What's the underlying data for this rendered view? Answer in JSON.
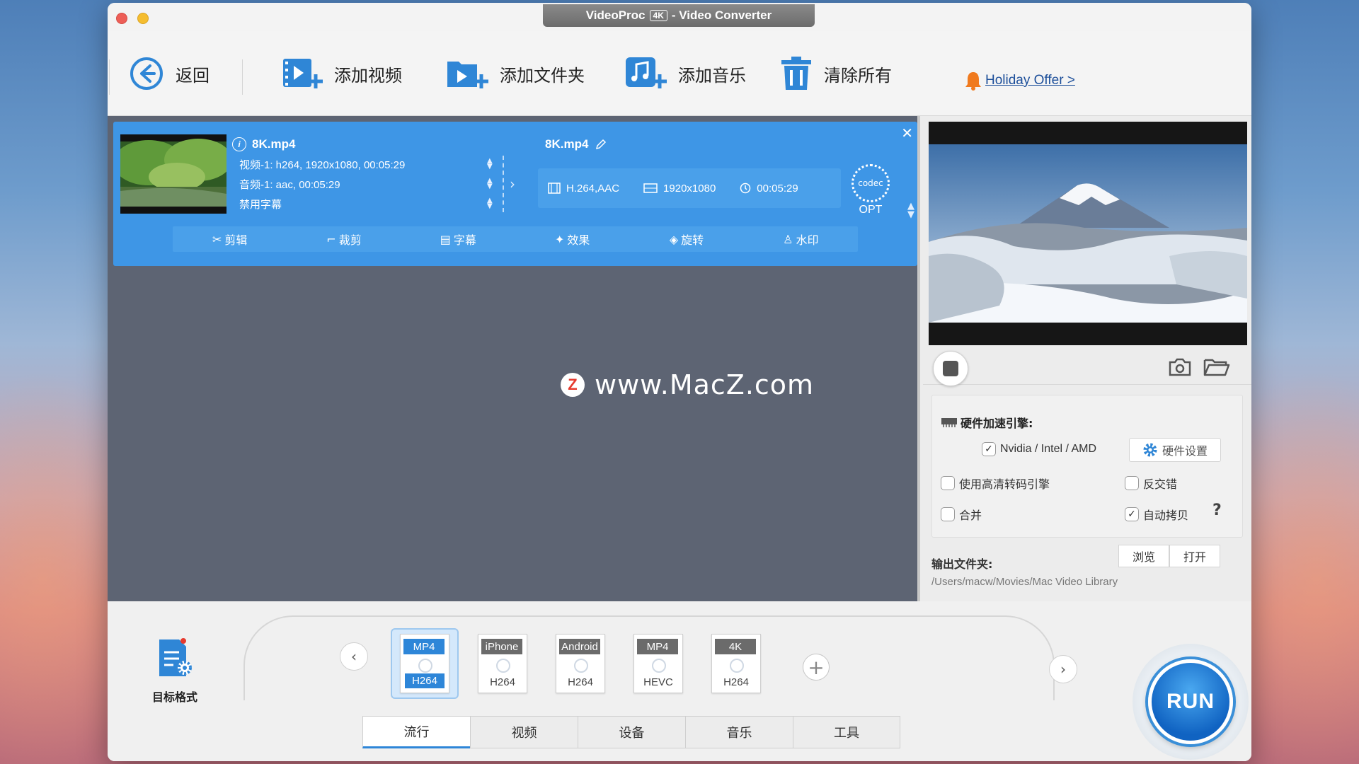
{
  "window": {
    "title_prefix": "VideoProc",
    "title_badge": "4K",
    "title_suffix": "- Video Converter"
  },
  "toolbar": {
    "back": "返回",
    "add_video": "添加视频",
    "add_folder": "添加文件夹",
    "add_music": "添加音乐",
    "clear_all": "清除所有",
    "holiday_offer": "Holiday Offer >"
  },
  "file_item": {
    "source_name": "8K.mp4",
    "video_track": "视频-1: h264, 1920x1080, 00:05:29",
    "audio_track": "音频-1: aac, 00:05:29",
    "subtitle": "禁用字幕",
    "output_name": "8K.mp4",
    "output_codec": "H.264,AAC",
    "output_resolution": "1920x1080",
    "output_duration": "00:05:29",
    "codec_label": "codec",
    "opt_label": "OPT"
  },
  "edit_bar": {
    "cut": "剪辑",
    "crop": "裁剪",
    "subtitle": "字幕",
    "effect": "效果",
    "rotate": "旋转",
    "watermark": "水印"
  },
  "watermark": {
    "logo": "Z",
    "text": "www.MacZ.com"
  },
  "settings": {
    "hw_title": "硬件加速引擎:",
    "hw_vendor": "Nvidia /  Intel / AMD",
    "hw_settings": "硬件设置",
    "hq_engine": "使用高清转码引擎",
    "deinterlace": "反交错",
    "merge": "合并",
    "auto_copy": "自动拷贝",
    "help": "?"
  },
  "output_folder": {
    "label": "输出文件夹:",
    "browse": "浏览",
    "open": "打开",
    "path": "/Users/macw/Movies/Mac Video Library"
  },
  "bottom": {
    "target_format": "目标格式",
    "formats": [
      {
        "top": "MP4",
        "bottom": "H264"
      },
      {
        "top": "iPhone",
        "bottom": "H264"
      },
      {
        "top": "Android",
        "bottom": "H264"
      },
      {
        "top": "MP4",
        "bottom": "HEVC"
      },
      {
        "top": "4K",
        "bottom": "H264"
      }
    ],
    "tabs": [
      "流行",
      "视频",
      "设备",
      "音乐",
      "工具"
    ],
    "run": "RUN"
  },
  "colors": {
    "accent_blue": "#3e96e6",
    "workarea_bg": "#5d6473",
    "run_blue": "#1063c2"
  }
}
